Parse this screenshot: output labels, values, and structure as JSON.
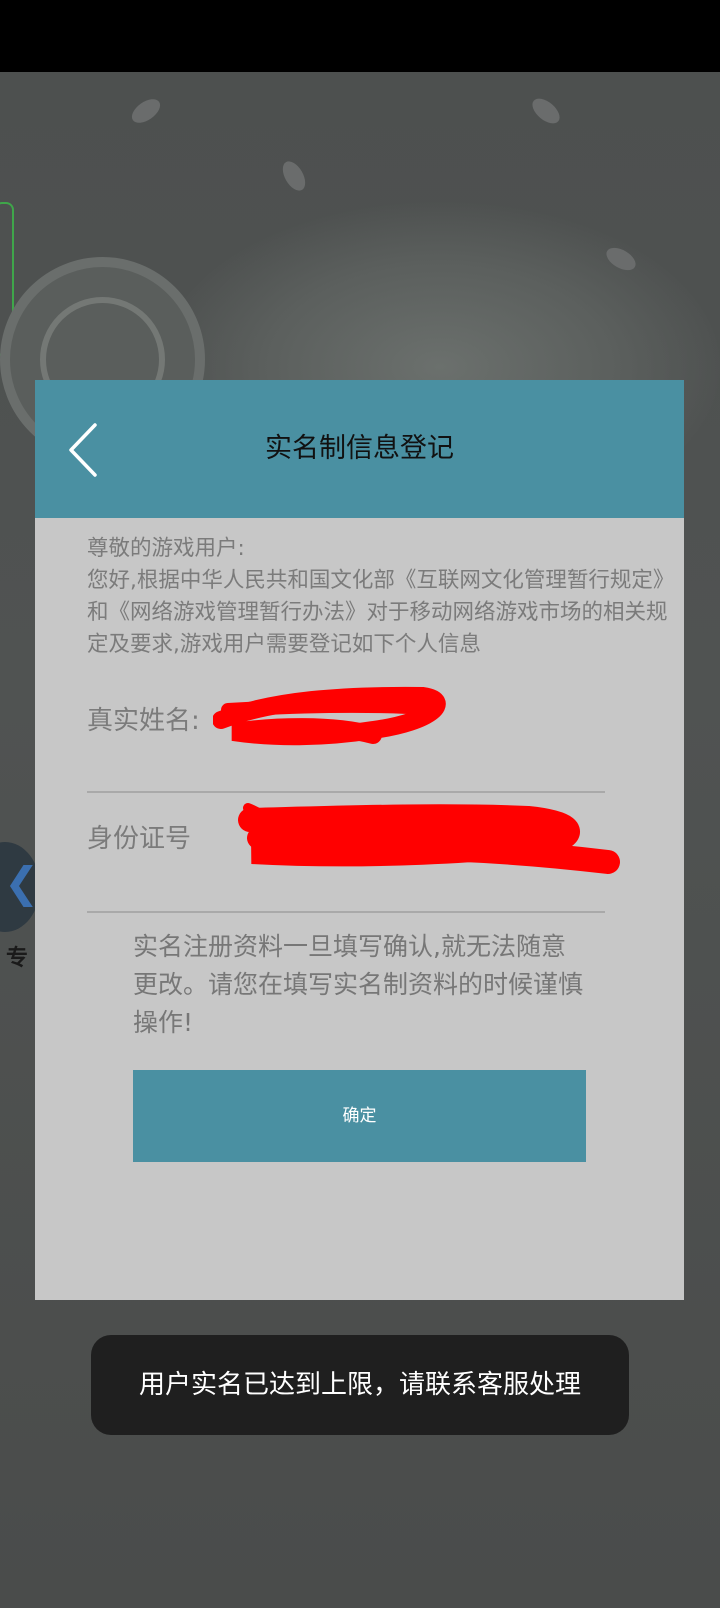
{
  "dialog": {
    "title": "实名制信息登记",
    "back_icon": "chevron-left-icon",
    "intro_greeting": "尊敬的游戏用户:",
    "intro_body": "您好,根据中华人民共和国文化部《互联网文化管理暂行规定》和《网络游戏管理暂行办法》对于移动网络游戏市场的相关规定及要求,游戏用户需要登记如下个人信息",
    "name_label": "真实姓名:",
    "id_label": "身份证号",
    "notice": "实名注册资料一旦填写确认,就无法随意更改。请您在填写实名制资料的时候谨慎操作!",
    "confirm_label": "确定",
    "header_color": "#4a90a2",
    "redaction_color": "#ff0000"
  },
  "background": {
    "left_text": "专",
    "right_text": "）。"
  },
  "toast": {
    "message": "用户实名已达到上限，请联系客服处理"
  }
}
